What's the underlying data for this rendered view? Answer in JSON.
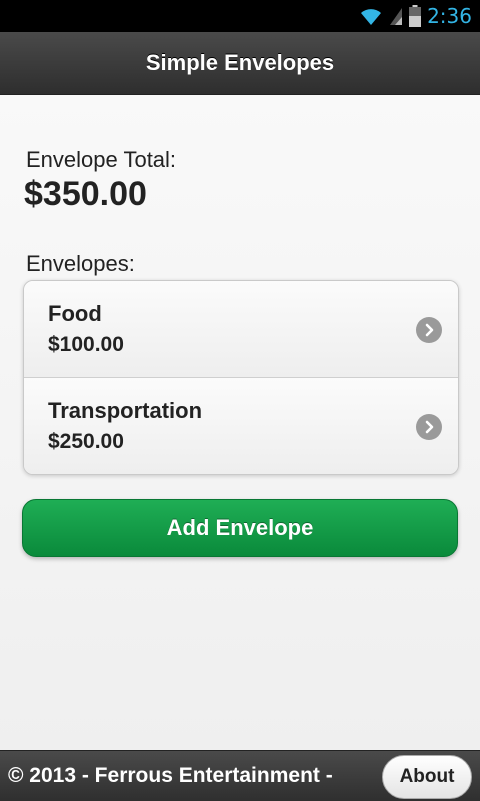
{
  "status_bar": {
    "time": "2:36",
    "icons": [
      "wifi-icon",
      "signal-icon",
      "battery-icon"
    ],
    "accent_color": "#33b5e5"
  },
  "header": {
    "title": "Simple Envelopes"
  },
  "summary": {
    "total_label": "Envelope Total:",
    "total_value": "$350.00",
    "envelopes_label": "Envelopes:"
  },
  "envelopes": [
    {
      "name": "Food",
      "amount": "$100.00"
    },
    {
      "name": "Transportation",
      "amount": "$250.00"
    }
  ],
  "actions": {
    "add_label": "Add Envelope",
    "add_color": "#0f9a45"
  },
  "footer": {
    "text": "© 2013 - Ferrous Entertainment -",
    "about_label": "About"
  }
}
